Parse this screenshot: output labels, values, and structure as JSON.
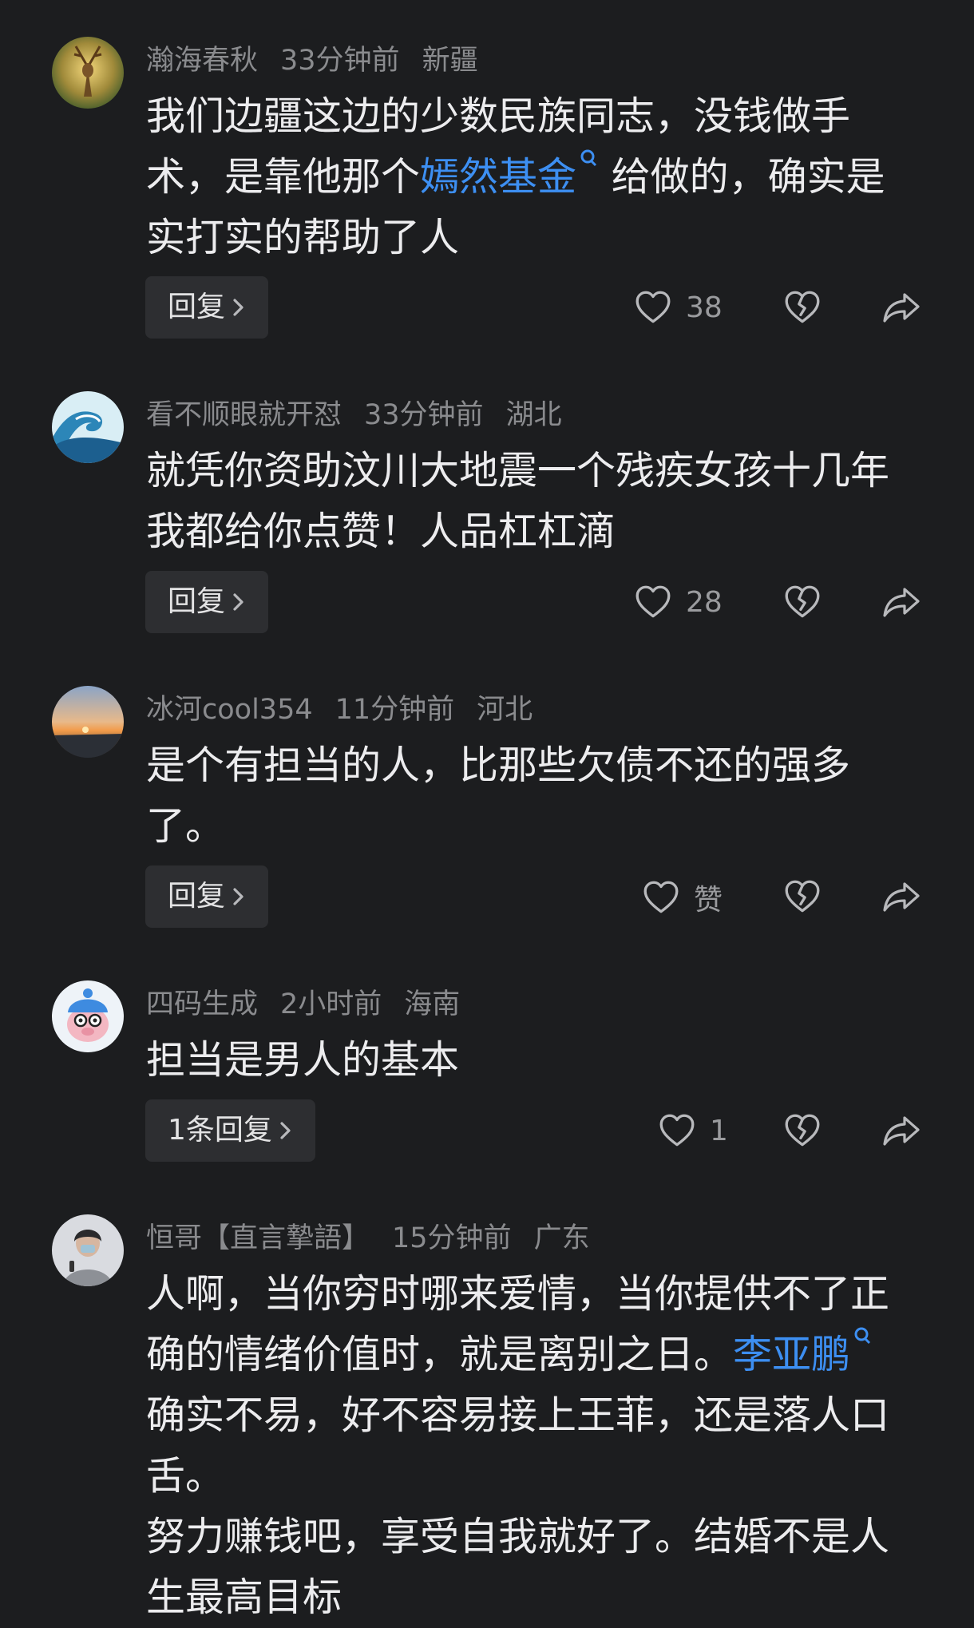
{
  "comments": [
    {
      "user": "瀚海春秋",
      "time": "33分钟前",
      "location": "新疆",
      "text_a": "我们边疆这边的少数民族同志，没钱做手术，是靠他那个",
      "link": "嫣然基金",
      "text_b": "给做的，确实是实打实的帮助了人",
      "reply_label": "回复",
      "likes": "38",
      "avatar_icon": "deer-avatar-icon"
    },
    {
      "user": "看不顺眼就开怼",
      "time": "33分钟前",
      "location": "湖北",
      "text": "就凭你资助汶川大地震一个残疾女孩十几年我都给你点赞！人品杠杠滴",
      "reply_label": "回复",
      "likes": "28",
      "avatar_icon": "wave-avatar-icon"
    },
    {
      "user": "冰河cool354",
      "time": "11分钟前",
      "location": "河北",
      "text": "是个有担当的人，比那些欠债不还的强多了。",
      "reply_label": "回复",
      "likes": "赞",
      "avatar_icon": "sunset-avatar-icon"
    },
    {
      "user": "四码生成",
      "time": "2小时前",
      "location": "海南",
      "text": "担当是男人的基本",
      "reply_label": "1条回复",
      "likes": "1",
      "avatar_icon": "piggy-avatar-icon"
    },
    {
      "user": "恒哥【直言摯語】",
      "time": "15分钟前",
      "location": "广东",
      "text_a": "人啊，当你穷时哪来爱情，当你提供不了正确的情绪价值时，就是离别之日。",
      "link": "李亚鹏",
      "text_b": "确实不易，好不容易接上王菲，还是落人口舌。",
      "text_c": "努力赚钱吧，享受自我就好了。结婚不是人生最高目标",
      "avatar_icon": "person-avatar-icon"
    }
  ],
  "colors": {
    "background": "#1c1d1f",
    "link": "#3d8ff2",
    "meta": "#8a8b8e"
  }
}
